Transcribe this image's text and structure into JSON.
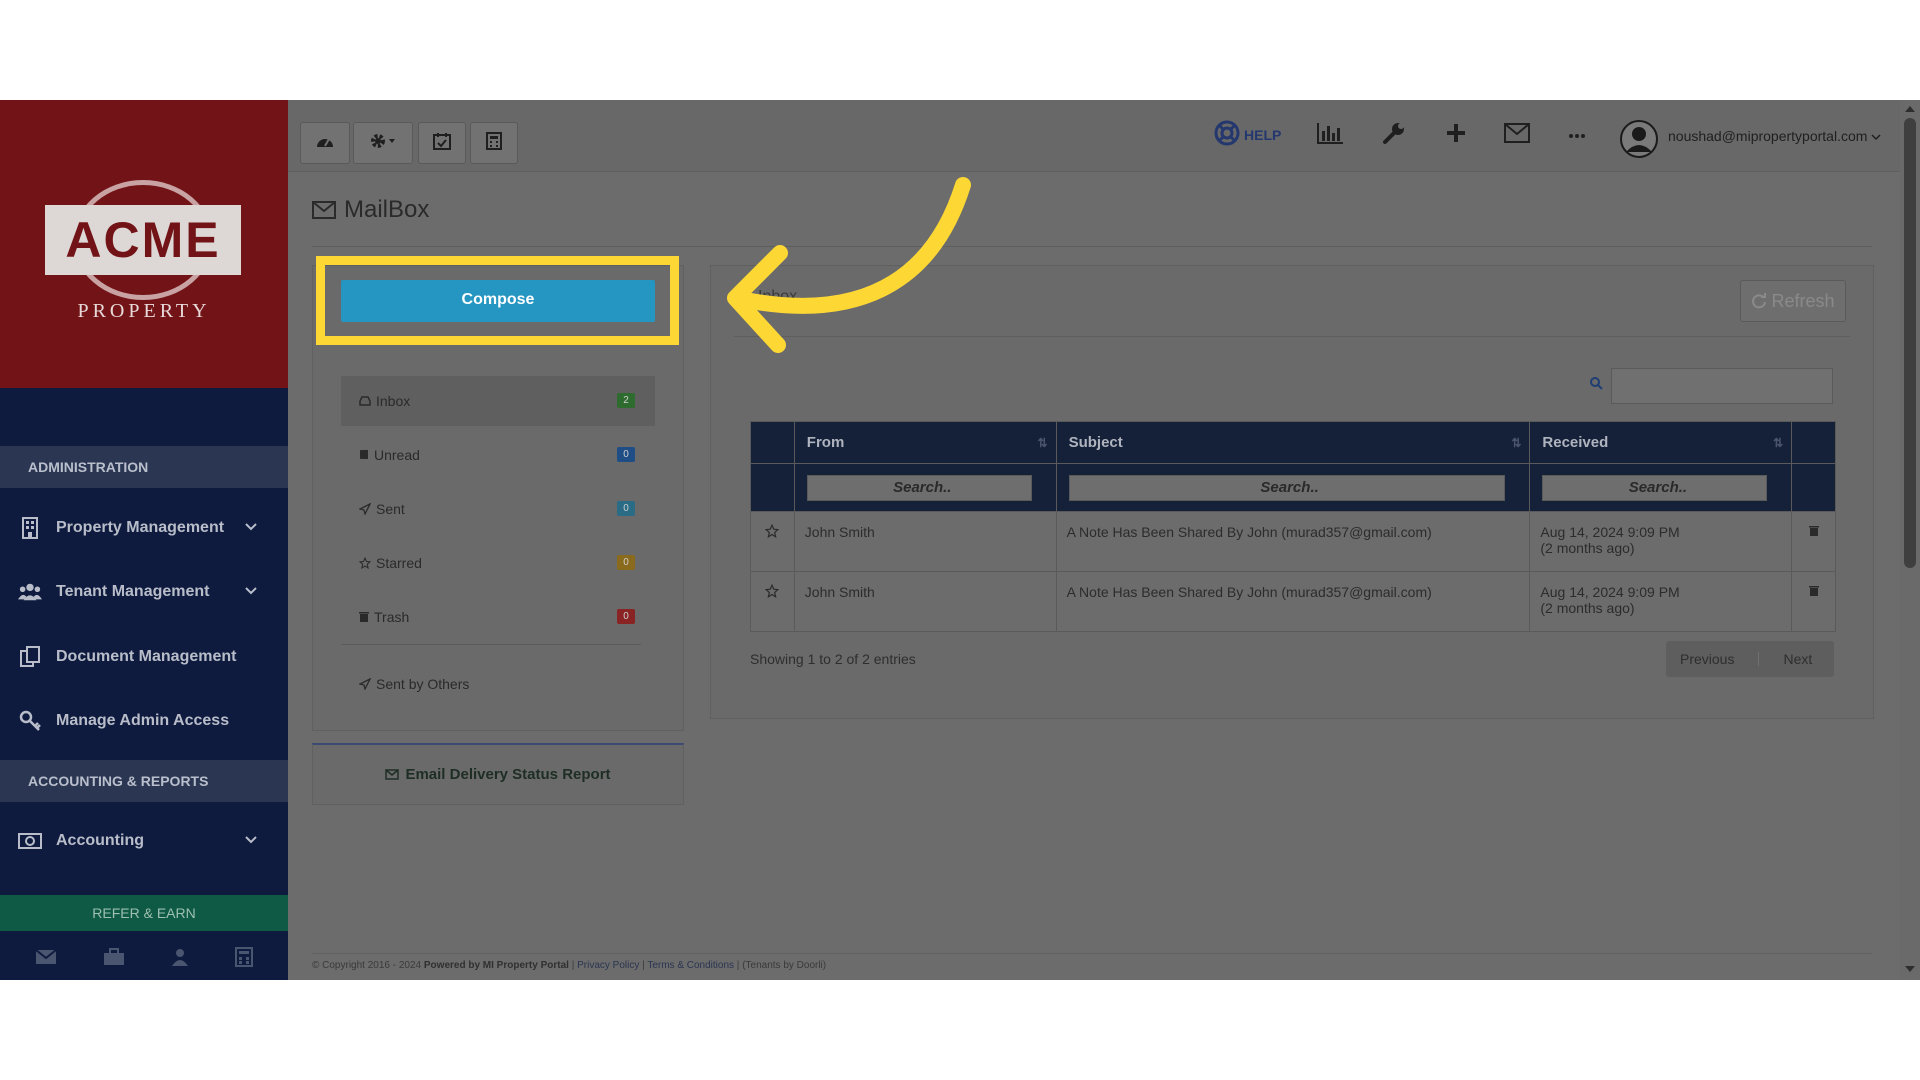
{
  "brand": {
    "logo_text": "ACME",
    "logo_sub": "PROPERTY"
  },
  "sidebar": {
    "section_admin": "ADMINISTRATION",
    "items_admin": [
      {
        "label": "Property Management",
        "icon": "building-icon",
        "expandable": true
      },
      {
        "label": "Tenant Management",
        "icon": "users-icon",
        "expandable": true
      },
      {
        "label": "Document Management",
        "icon": "documents-icon",
        "expandable": false
      },
      {
        "label": "Manage Admin Access",
        "icon": "key-icon",
        "expandable": false
      }
    ],
    "section_accounting": "ACCOUNTING & REPORTS",
    "accounting_label": "Accounting",
    "refer_label": "REFER & EARN",
    "bottom_icons": [
      "envelope-icon",
      "briefcase-icon",
      "user-icon",
      "calculator-icon"
    ]
  },
  "topbar": {
    "help_label": "HELP",
    "user_email": "noushad@mipropertyportal.com",
    "icons": [
      "dashboard-icon",
      "gear-icon",
      "calendar-icon",
      "calculator-icon",
      "help-icon",
      "bar-chart-icon",
      "wrench-icon",
      "plus-icon",
      "envelope-icon",
      "more-icon",
      "avatar"
    ]
  },
  "page": {
    "title": "MailBox"
  },
  "mailbox": {
    "compose_label": "Compose",
    "folders": [
      {
        "label": "Inbox",
        "count": "2",
        "badge_color": "#2e6b2e",
        "active": true
      },
      {
        "label": "Unread",
        "count": "0",
        "badge_color": "#1f4e86"
      },
      {
        "label": "Sent",
        "count": "0",
        "badge_color": "#2a6b86"
      },
      {
        "label": "Starred",
        "count": "0",
        "badge_color": "#8a6a1c"
      },
      {
        "label": "Trash",
        "count": "0",
        "badge_color": "#8a2424"
      }
    ],
    "sent_by_others_label": "Sent by Others",
    "delivery_report_label": "Email Delivery Status Report"
  },
  "inbox": {
    "header": "Inbox",
    "refresh_label": "Refresh",
    "columns": [
      "From",
      "Subject",
      "Received"
    ],
    "column_search_placeholder": "Search..",
    "rows": [
      {
        "from": "John Smith",
        "subject": "A Note Has Been Shared By John (murad357@gmail.com)",
        "received": "Aug 14, 2024 9:09 PM",
        "received_ago": "(2 months ago)"
      },
      {
        "from": "John Smith",
        "subject": "A Note Has Been Shared By John (murad357@gmail.com)",
        "received": "Aug 14, 2024 9:09 PM",
        "received_ago": "(2 months ago)"
      }
    ],
    "entries_info": "Showing 1 to 2 of 2 entries",
    "prev_label": "Previous",
    "next_label": "Next"
  },
  "footer": {
    "copyright": "© Copyright 2016 - 2024",
    "powered": "Powered by MI Property Portal",
    "privacy": "Privacy Policy",
    "terms": "Terms & Conditions",
    "tenants": "(Tenants by Doorli)"
  },
  "colors": {
    "accent": "#2596c1",
    "highlight": "#fdd835",
    "sidebar": "#0e1b3e",
    "logo_bg": "#721417"
  }
}
